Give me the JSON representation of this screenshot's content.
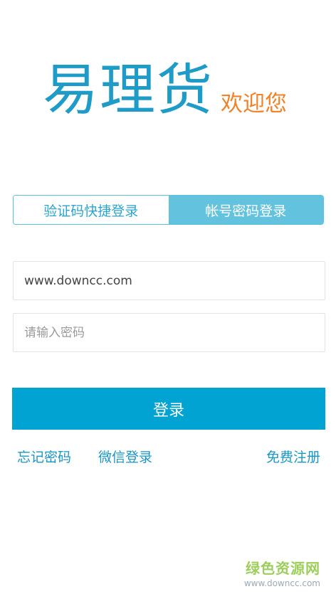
{
  "logo": {
    "app_name": "易理货",
    "welcome": "欢迎您"
  },
  "tabs": [
    {
      "label": "验证码快捷登录",
      "active": false
    },
    {
      "label": "帐号密码登录",
      "active": true
    }
  ],
  "form": {
    "username_value": "www.downcc.com",
    "password_placeholder": "请输入密码"
  },
  "login_button_label": "登录",
  "links": {
    "forgot_password": "忘记密码",
    "wechat_login": "微信登录",
    "register": "免费注册"
  },
  "watermark": {
    "title": "绿色资源网",
    "url": "www.downcc.com"
  },
  "colors": {
    "brand_blue": "#1e9bc6",
    "welcome_orange": "#f0832a",
    "button_blue": "#00a3d1",
    "active_tab": "#63c3de"
  }
}
